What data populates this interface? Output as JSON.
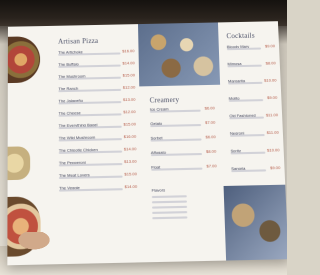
{
  "menu": {
    "left": {
      "title": "Artisan Pizza",
      "items": [
        {
          "name": "The Artichoke",
          "price": "$16.00"
        },
        {
          "name": "The Buffalo",
          "price": "$14.00"
        },
        {
          "name": "The Mushroom",
          "price": "$15.00"
        },
        {
          "name": "The Ranch",
          "price": "$12.00"
        },
        {
          "name": "The Jalapeño",
          "price": "$13.00"
        },
        {
          "name": "The Cheese",
          "price": "$12.00"
        },
        {
          "name": "The Everything Bagel",
          "price": "$15.00"
        },
        {
          "name": "The Wild Mushroom",
          "price": "$16.00"
        },
        {
          "name": "The Chipotle Chicken",
          "price": "$14.00"
        },
        {
          "name": "The Pepperoni",
          "price": "$13.00"
        },
        {
          "name": "The Meat Lovers",
          "price": "$15.00"
        },
        {
          "name": "The Veggie",
          "price": "$14.00"
        }
      ]
    },
    "middle": {
      "title": "Creamery",
      "items": [
        {
          "name": "Ice Cream",
          "price": "$6.00"
        },
        {
          "name": "Gelato",
          "price": "$7.00"
        },
        {
          "name": "Sorbet",
          "price": "$6.00"
        },
        {
          "name": "Affogato",
          "price": "$8.00"
        },
        {
          "name": "Float",
          "price": "$7.00"
        }
      ],
      "sauces_heading": "Flavors"
    },
    "right": {
      "title": "Cocktails",
      "items": [
        {
          "name": "Bloody Mary",
          "price": "$9.00"
        },
        {
          "name": "Mimosa",
          "price": "$8.00"
        },
        {
          "name": "Margarita",
          "price": "$10.00"
        },
        {
          "name": "Mojito",
          "price": "$9.00"
        },
        {
          "name": "Old Fashioned",
          "price": "$11.00"
        },
        {
          "name": "Negroni",
          "price": "$11.00"
        },
        {
          "name": "Spritz",
          "price": "$10.00"
        },
        {
          "name": "Sangria",
          "price": "$9.00"
        }
      ]
    }
  }
}
